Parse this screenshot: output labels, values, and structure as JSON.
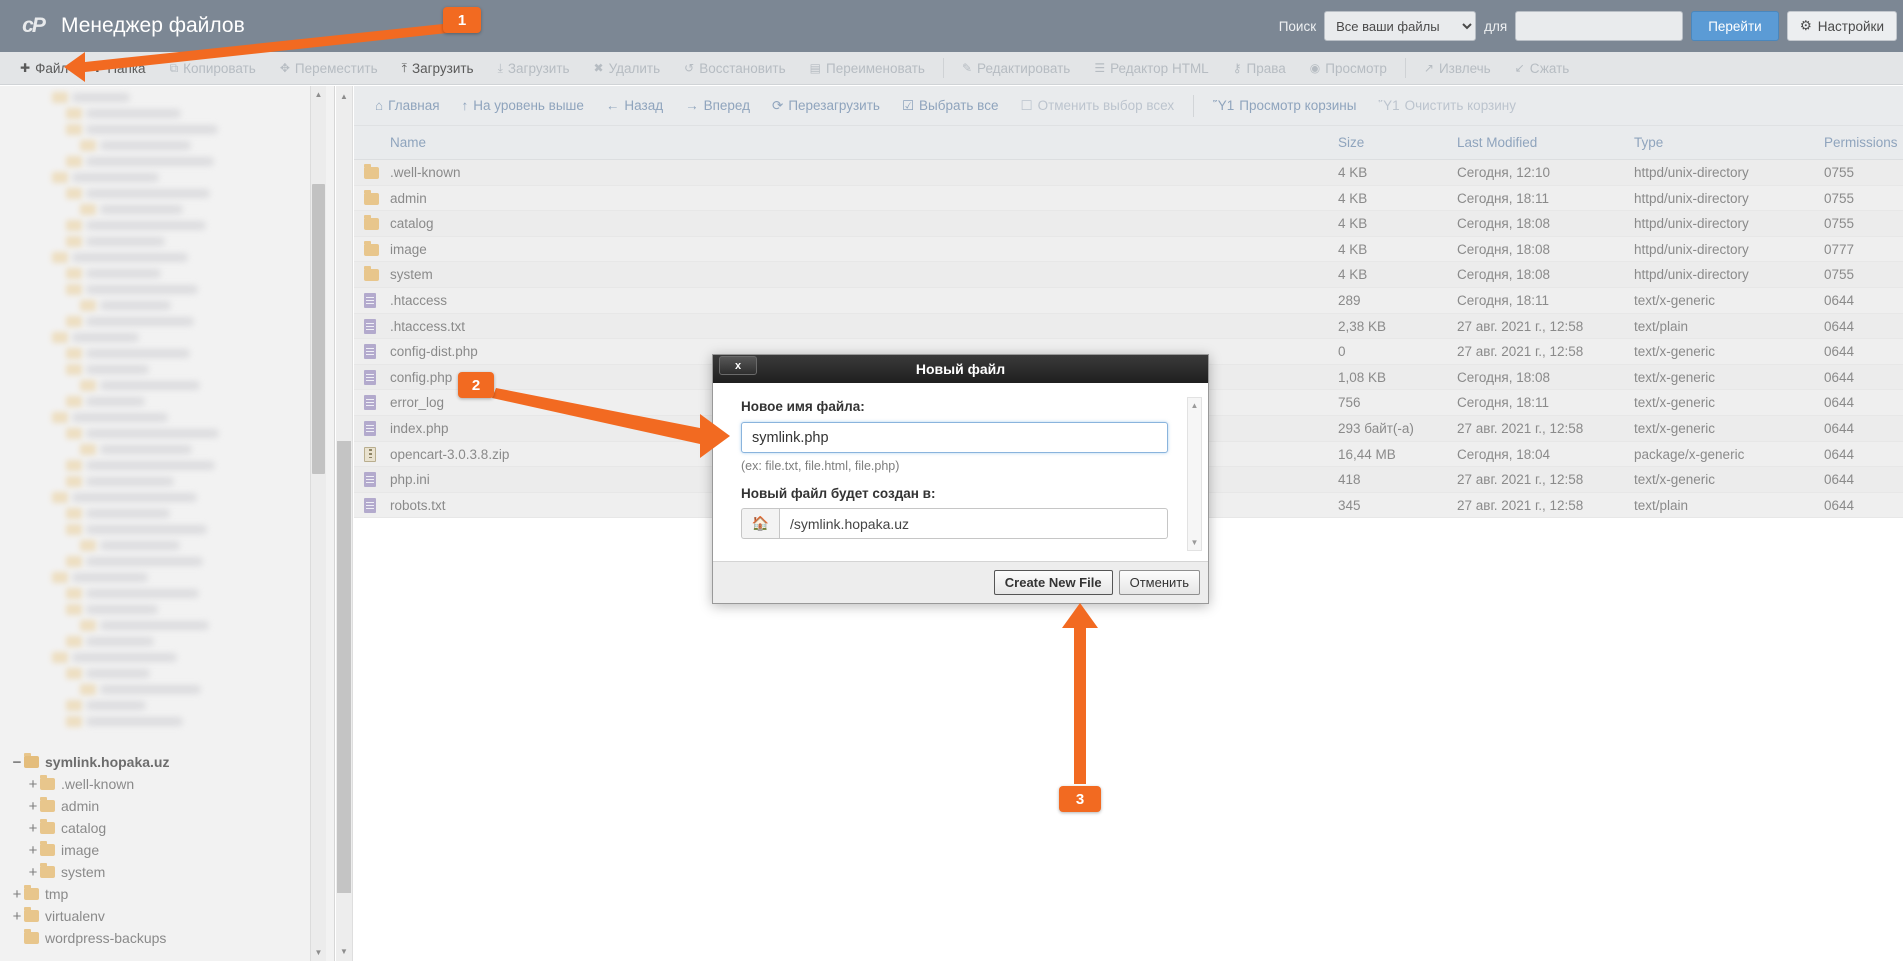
{
  "header": {
    "logo": "cp-logo",
    "title": "Менеджер файлов",
    "search_label": "Поиск",
    "search_scope_selected": "Все ваши файлы",
    "search_scope_options": [
      "Все ваши файлы"
    ],
    "search_for_label": "для",
    "search_value": "",
    "search_placeholder": "",
    "go_label": "Перейти",
    "settings_label": "Настройки"
  },
  "toolbar": {
    "items": [
      {
        "label": "Файл",
        "icon": "plus-icon",
        "disabled": false
      },
      {
        "label": "Папка",
        "icon": "plus-icon",
        "disabled": false
      },
      {
        "label": "Копировать",
        "icon": "copy-icon",
        "disabled": true
      },
      {
        "label": "Переместить",
        "icon": "move-icon",
        "disabled": true
      },
      {
        "label": "Загрузить",
        "icon": "upload-icon",
        "disabled": false
      },
      {
        "label": "Загрузить",
        "icon": "download-icon",
        "disabled": true
      },
      {
        "label": "Удалить",
        "icon": "delete-x-icon",
        "disabled": true
      },
      {
        "label": "Восстановить",
        "icon": "restore-icon",
        "disabled": true
      },
      {
        "label": "Переименовать",
        "icon": "rename-icon",
        "disabled": true
      },
      {
        "label": "Редактировать",
        "icon": "pencil-icon",
        "disabled": true
      },
      {
        "label": "Редактор HTML",
        "icon": "html-editor-icon",
        "disabled": true
      },
      {
        "label": "Права",
        "icon": "key-icon",
        "disabled": true
      },
      {
        "label": "Просмотр",
        "icon": "eye-icon",
        "disabled": true
      },
      {
        "label": "Извлечь",
        "icon": "extract-icon",
        "disabled": true
      },
      {
        "label": "Сжать",
        "icon": "compress-icon",
        "disabled": true
      }
    ]
  },
  "navbar": {
    "items": [
      {
        "label": "Главная",
        "icon": "home-icon",
        "muted": false
      },
      {
        "label": "На уровень выше",
        "icon": "up-arrow-icon",
        "muted": false
      },
      {
        "label": "Назад",
        "icon": "left-arrow-icon",
        "muted": false
      },
      {
        "label": "Вперед",
        "icon": "right-arrow-icon",
        "muted": false
      },
      {
        "label": "Перезагрузить",
        "icon": "reload-icon",
        "muted": false
      },
      {
        "label": "Выбрать все",
        "icon": "checkbox-checked-icon",
        "muted": false
      },
      {
        "label": "Отменить выбор всех",
        "icon": "checkbox-empty-icon",
        "muted": true
      },
      {
        "label": "Просмотр корзины",
        "icon": "trash-icon",
        "muted": false
      },
      {
        "label": "Очистить корзину",
        "icon": "trash-icon",
        "muted": true
      }
    ]
  },
  "table": {
    "columns": [
      "Name",
      "Size",
      "Last Modified",
      "Type",
      "Permissions"
    ],
    "rows": [
      {
        "icon": "folder-icon",
        "name": ".well-known",
        "size": "4 KB",
        "modified": "Сегодня, 12:10",
        "type": "httpd/unix-directory",
        "perms": "0755"
      },
      {
        "icon": "folder-icon",
        "name": "admin",
        "size": "4 KB",
        "modified": "Сегодня, 18:11",
        "type": "httpd/unix-directory",
        "perms": "0755"
      },
      {
        "icon": "folder-icon",
        "name": "catalog",
        "size": "4 KB",
        "modified": "Сегодня, 18:08",
        "type": "httpd/unix-directory",
        "perms": "0755"
      },
      {
        "icon": "folder-icon",
        "name": "image",
        "size": "4 KB",
        "modified": "Сегодня, 18:08",
        "type": "httpd/unix-directory",
        "perms": "0777"
      },
      {
        "icon": "folder-icon",
        "name": "system",
        "size": "4 KB",
        "modified": "Сегодня, 18:08",
        "type": "httpd/unix-directory",
        "perms": "0755"
      },
      {
        "icon": "file-icon",
        "name": ".htaccess",
        "size": "289",
        "modified": "Сегодня, 18:11",
        "type": "text/x-generic",
        "perms": "0644"
      },
      {
        "icon": "file-icon",
        "name": ".htaccess.txt",
        "size": "2,38 KB",
        "modified": "27 авг. 2021 г., 12:58",
        "type": "text/plain",
        "perms": "0644"
      },
      {
        "icon": "file-icon",
        "name": "config-dist.php",
        "size": "0",
        "modified": "27 авг. 2021 г., 12:58",
        "type": "text/x-generic",
        "perms": "0644"
      },
      {
        "icon": "file-icon",
        "name": "config.php",
        "size": "1,08 KB",
        "modified": "Сегодня, 18:08",
        "type": "text/x-generic",
        "perms": "0644"
      },
      {
        "icon": "file-icon",
        "name": "error_log",
        "size": "756",
        "modified": "Сегодня, 18:11",
        "type": "text/x-generic",
        "perms": "0644"
      },
      {
        "icon": "file-icon",
        "name": "index.php",
        "size": "293 байт(-а)",
        "modified": "27 авг. 2021 г., 12:58",
        "type": "text/x-generic",
        "perms": "0644"
      },
      {
        "icon": "zip-icon",
        "name": "opencart-3.0.3.8.zip",
        "size": "16,44 МВ",
        "modified": "Сегодня, 18:04",
        "type": "package/x-generic",
        "perms": "0644"
      },
      {
        "icon": "file-icon",
        "name": "php.ini",
        "size": "418",
        "modified": "27 авг. 2021 г., 12:58",
        "type": "text/x-generic",
        "perms": "0644"
      },
      {
        "icon": "file-icon",
        "name": "robots.txt",
        "size": "345",
        "modified": "27 авг. 2021 г., 12:58",
        "type": "text/plain",
        "perms": "0644"
      }
    ]
  },
  "sidebar": {
    "tree": [
      {
        "label": "symlink.hopaka.uz",
        "toggle": "−",
        "indent": 0,
        "root": true,
        "open": true
      },
      {
        "label": ".well-known",
        "toggle": "+",
        "indent": 1,
        "root": false,
        "open": false
      },
      {
        "label": "admin",
        "toggle": "+",
        "indent": 1,
        "root": false,
        "open": false
      },
      {
        "label": "catalog",
        "toggle": "+",
        "indent": 1,
        "root": false,
        "open": false
      },
      {
        "label": "image",
        "toggle": "+",
        "indent": 1,
        "root": false,
        "open": false
      },
      {
        "label": "system",
        "toggle": "+",
        "indent": 1,
        "root": false,
        "open": false
      },
      {
        "label": "tmp",
        "toggle": "+",
        "indent": 0,
        "root": false,
        "open": false
      },
      {
        "label": "virtualenv",
        "toggle": "+",
        "indent": 0,
        "root": false,
        "open": false
      },
      {
        "label": "wordpress-backups",
        "toggle": "",
        "indent": 0,
        "root": false,
        "open": false
      }
    ]
  },
  "modal": {
    "title": "Новый файл",
    "close_label": "x",
    "name_label": "Новое имя файла:",
    "name_value": "symlink.php",
    "name_placeholder": "",
    "hint": "(ex: file.txt, file.html, file.php)",
    "dir_label": "Новый файл будет создан в:",
    "home_icon": "home-icon",
    "path_value": "/symlink.hopaka.uz",
    "create_label": "Create New File",
    "cancel_label": "Отменить"
  },
  "annotations": {
    "badges": [
      {
        "id": "badge1",
        "label": "1"
      },
      {
        "id": "badge2",
        "label": "2"
      },
      {
        "id": "badge3",
        "label": "3"
      }
    ],
    "accent_color": "#f26a21"
  }
}
